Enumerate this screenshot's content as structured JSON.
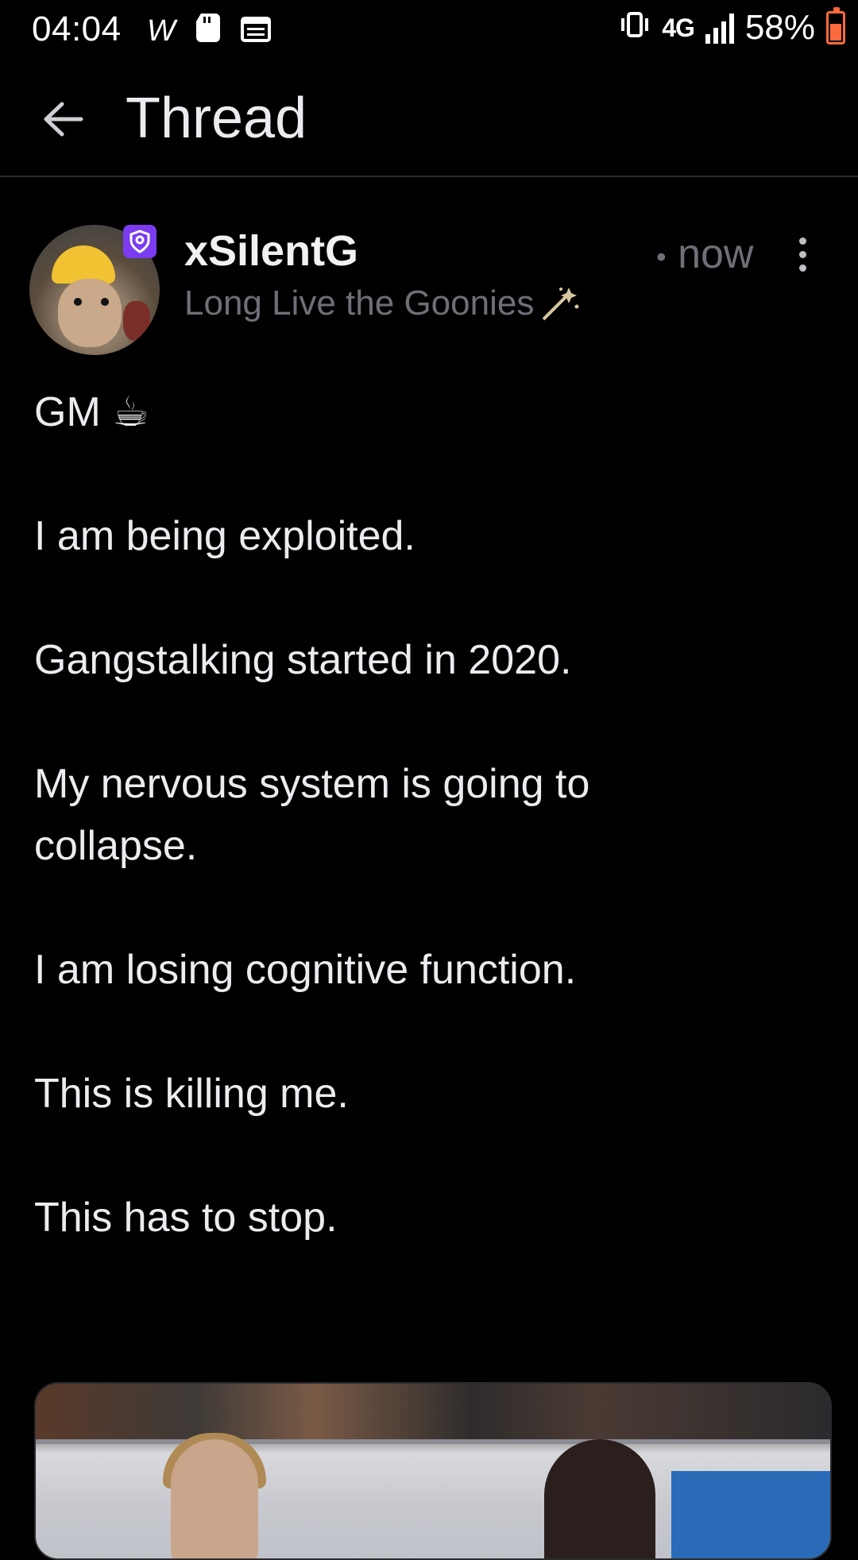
{
  "status_bar": {
    "time": "04:04",
    "left_icons": [
      "carrier-w-icon",
      "sd-card-icon",
      "calendar-icon"
    ],
    "right_icons": [
      "vibrate-icon",
      "network-4g-icon",
      "signal-icon",
      "battery-icon"
    ],
    "network_label": "4G",
    "battery_percent": "58%",
    "battery_level": 0.58,
    "battery_color": "#ff6a3d"
  },
  "header": {
    "back_icon": "arrow-left-icon",
    "title": "Thread"
  },
  "post": {
    "author": {
      "username": "xSilentG",
      "bio": "Long Live the Goonies",
      "bio_emoji": "magic-wand-icon",
      "verified_badge_icon": "shield-badge-icon",
      "badge_color": "#7b3cf0"
    },
    "time_separator": "•",
    "timestamp": "now",
    "more_icon": "more-vertical-icon",
    "lines": [
      "GM ☕",
      "I am being exploited.",
      "Gangstalking started in 2020.",
      "My nervous system is going to collapse.",
      "I am losing cognitive function.",
      "This is killing me.",
      "This has to stop."
    ],
    "media": {
      "type": "image"
    }
  }
}
